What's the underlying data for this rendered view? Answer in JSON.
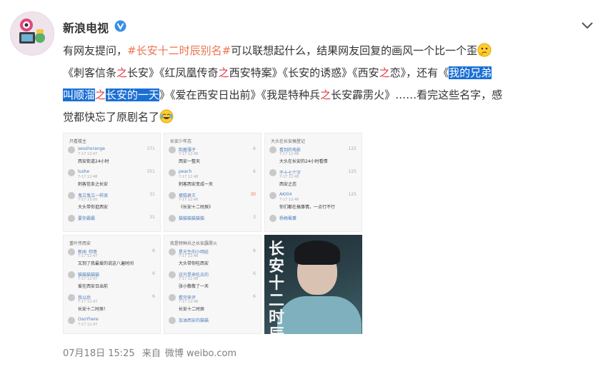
{
  "post": {
    "username": "新浪电视",
    "verified_icon": "verified-v-icon",
    "text": {
      "t1": "有网友提问，",
      "hashtag": "#长安十二时辰别名#",
      "t2": "可以联想起什么，结果网友回复的画风一个比一个歪",
      "t3": "《刺客信条",
      "zhi1": "之",
      "t4": "长安》《红凤凰传奇",
      "zhi2": "之",
      "t5": "西安特案》《长安的诱惑》《西安",
      "zhi3": "之",
      "t6": "恋》，还有《",
      "sel1": "我的兄弟",
      "sel2": "叫顺溜",
      "zhi4": "之",
      "sel3": "长安的一天",
      "t7": "》《爱在西安日出前》《我是特种兵",
      "zhi5": "之",
      "t8": "长安霹雳火》……看完这些名字，感",
      "t9": "觉都快忘了原剧名了"
    },
    "footer": {
      "date": "07月18日 15:25",
      "source_prefix": "来自",
      "source": "微博 weibo.com"
    }
  },
  "thumbs": [
    {
      "header": "只看楼主",
      "comments": [
        {
          "name": "sesshorange",
          "meta": "7-17 12:47",
          "body": "西安街道24小时",
          "likes": "371"
        },
        {
          "name": "lushe",
          "meta": "7-17 12:48",
          "body": "刺客信条之长安",
          "likes": "351"
        },
        {
          "name": "鬼泣鬼泣一样哭",
          "meta": "7-17 13:00",
          "body": "大头带你逛西安",
          "likes": "31"
        },
        {
          "name": "要你霸霸",
          "meta": "7-17 14:02",
          "body": "",
          "likes": "31"
        }
      ]
    },
    {
      "header": "长安少年志",
      "comments": [
        {
          "name": "韵菌薄子",
          "meta": "7-17 12:48",
          "body": "西安一整天",
          "likes": "6"
        },
        {
          "name": "peach",
          "meta": "7-17 12:48",
          "body": "刺客西安变成一天",
          "likes": "6"
        },
        {
          "name": "蛋糕君王",
          "meta": "7-17 12:48",
          "body": "《长安十二时辰》",
          "likes": "30"
        },
        {
          "name": "猫猫猫猫猫猫",
          "meta": "",
          "body": "",
          "likes": "3"
        }
      ]
    },
    {
      "header": "大头在长安搞登记",
      "comments": [
        {
          "name": "看到的电影",
          "meta": "7-17 12:48",
          "body": "大头在长安的24小时看情",
          "likes": "125"
        },
        {
          "name": "不十七个字",
          "meta": "7-17 12:48",
          "body": "西安之恋",
          "likes": "125"
        },
        {
          "name": "AKI04",
          "meta": "7-17 12:48",
          "body": "你们都在搞事情，一点行不行",
          "likes": "125"
        },
        {
          "name": "杨梅蜀黍",
          "meta": "",
          "body": "",
          "likes": ""
        }
      ]
    },
    {
      "header": "重叶传西安",
      "comments": [
        {
          "name": "新闻_帅哥",
          "meta": "7-17 12:47",
          "body": "又到了我最爱的说这八遍时间",
          "likes": "6"
        },
        {
          "name": "猫猫猫猫猫",
          "meta": "7-17 12:47",
          "body": "爱在西安日出前",
          "likes": "6"
        },
        {
          "name": "我以后",
          "meta": "7-17 12:47",
          "body": "长安十二时辰！",
          "likes": "6"
        },
        {
          "name": "OsoYhere",
          "meta": "7-17 12:47",
          "body": "",
          "likes": ""
        }
      ]
    },
    {
      "header": "我是特种兵之长安霹雳火",
      "comments": [
        {
          "name": "星光生的小明娃",
          "meta": "7-17 12:48",
          "body": "大头带你吃西安",
          "likes": "6"
        },
        {
          "name": "这只是来吃瓜的",
          "meta": "7-17 12:48",
          "body": "张小敬敬了一天",
          "likes": "6"
        },
        {
          "name": "看完来评",
          "meta": "7-17 12:48",
          "body": "长安十二时辰",
          "likes": "6"
        },
        {
          "name": "加油西安的猫猫",
          "meta": "",
          "body": "",
          "likes": ""
        }
      ]
    },
    {
      "photo": true,
      "callig": "长安十二时辰",
      "comments": []
    }
  ],
  "icons": {
    "more": "chevron-down-icon",
    "emoji1": "thinking-emoji-icon",
    "emoji2": "laugh-cry-emoji-icon"
  }
}
